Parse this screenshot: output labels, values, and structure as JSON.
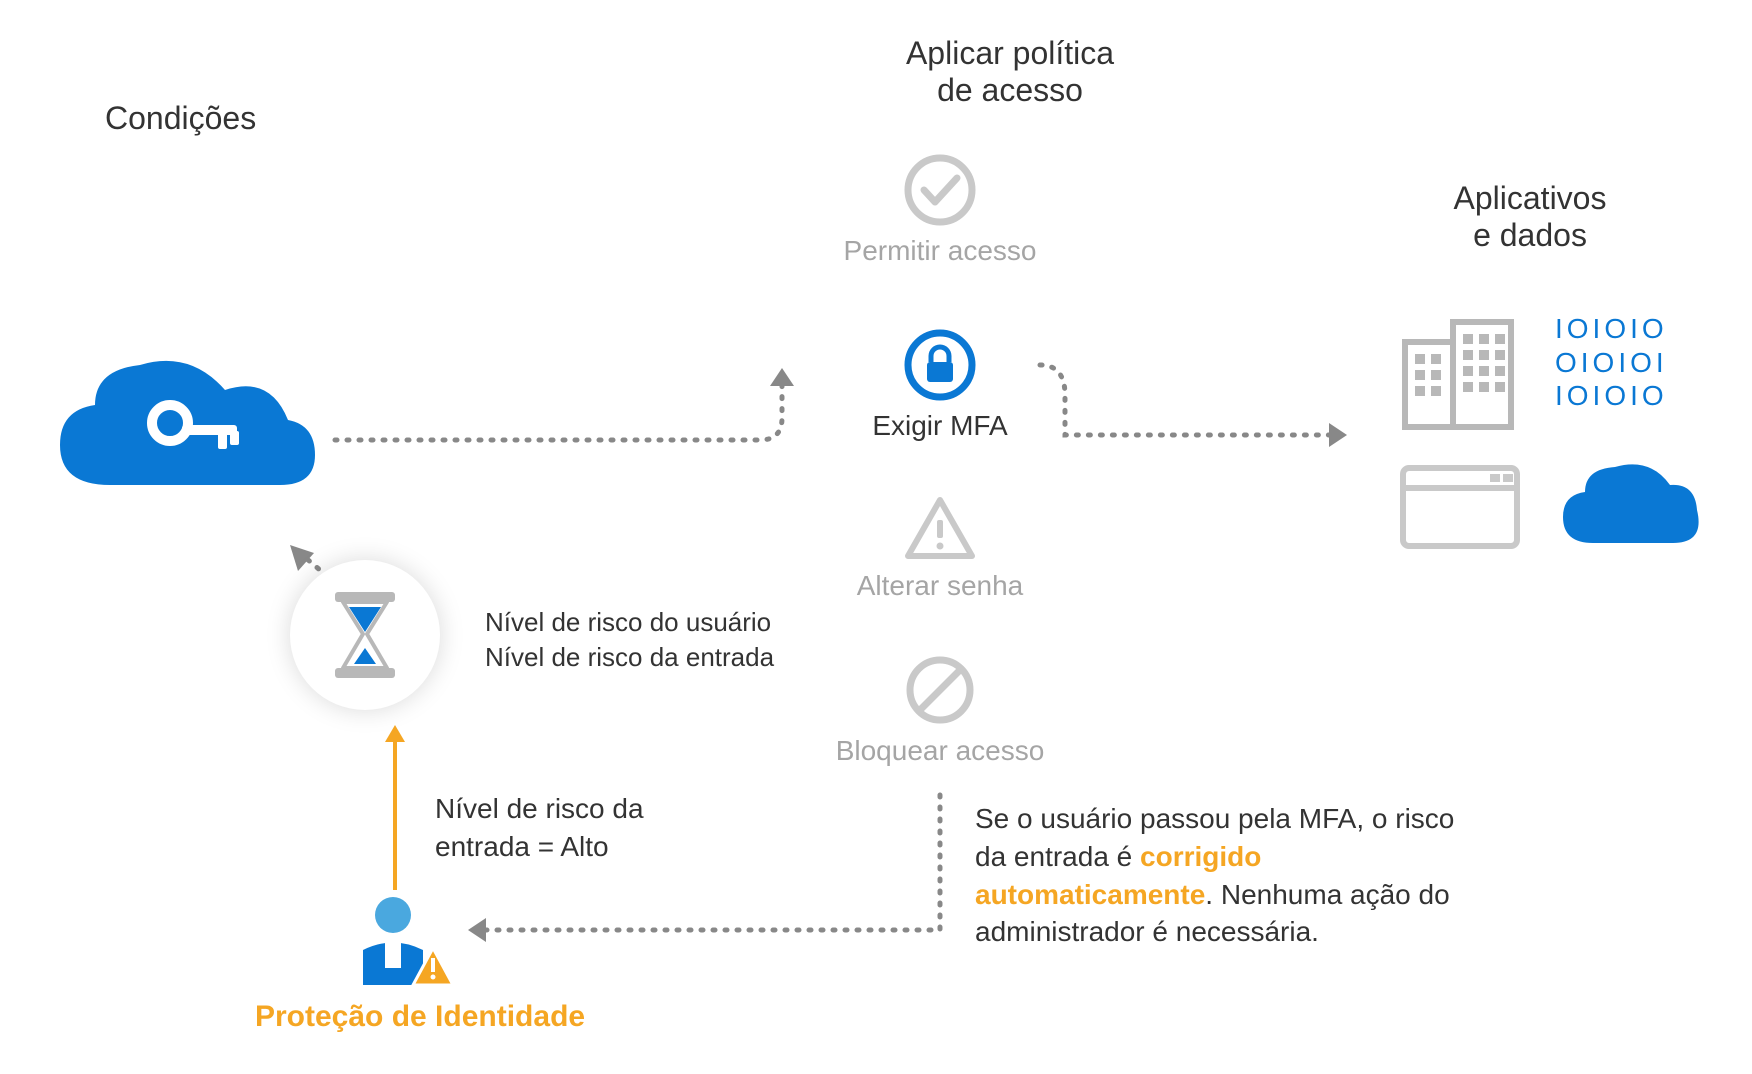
{
  "headers": {
    "conditions": "Condições",
    "policy_line1": "Aplicar política",
    "policy_line2": "de acesso",
    "apps_line1": "Aplicativos",
    "apps_line2": "e dados"
  },
  "policies": {
    "allow": "Permitir acesso",
    "mfa": "Exigir MFA",
    "password": "Alterar senha",
    "block": "Bloquear acesso"
  },
  "risk": {
    "user_label": "Nível de risco do usuário",
    "signin_label": "Nível de risco da entrada",
    "value_line1": "Nível de risco da",
    "value_line2": "entrada = Alto"
  },
  "identity_protection": "Proteção de Identidade",
  "explanation": {
    "pre": "Se o usuário passou pela MFA, o risco da entrada é ",
    "highlight": "corrigido automaticamente",
    "post": ". Nenhuma ação do administrador é necessária."
  },
  "binary": {
    "l1": "IOIOIO",
    "l2": "OIOIOI",
    "l3": "IOIOIO"
  },
  "colors": {
    "brand_blue": "#0a78d4",
    "dim_gray": "#c2c2c2",
    "accent_orange": "#f5a623"
  }
}
